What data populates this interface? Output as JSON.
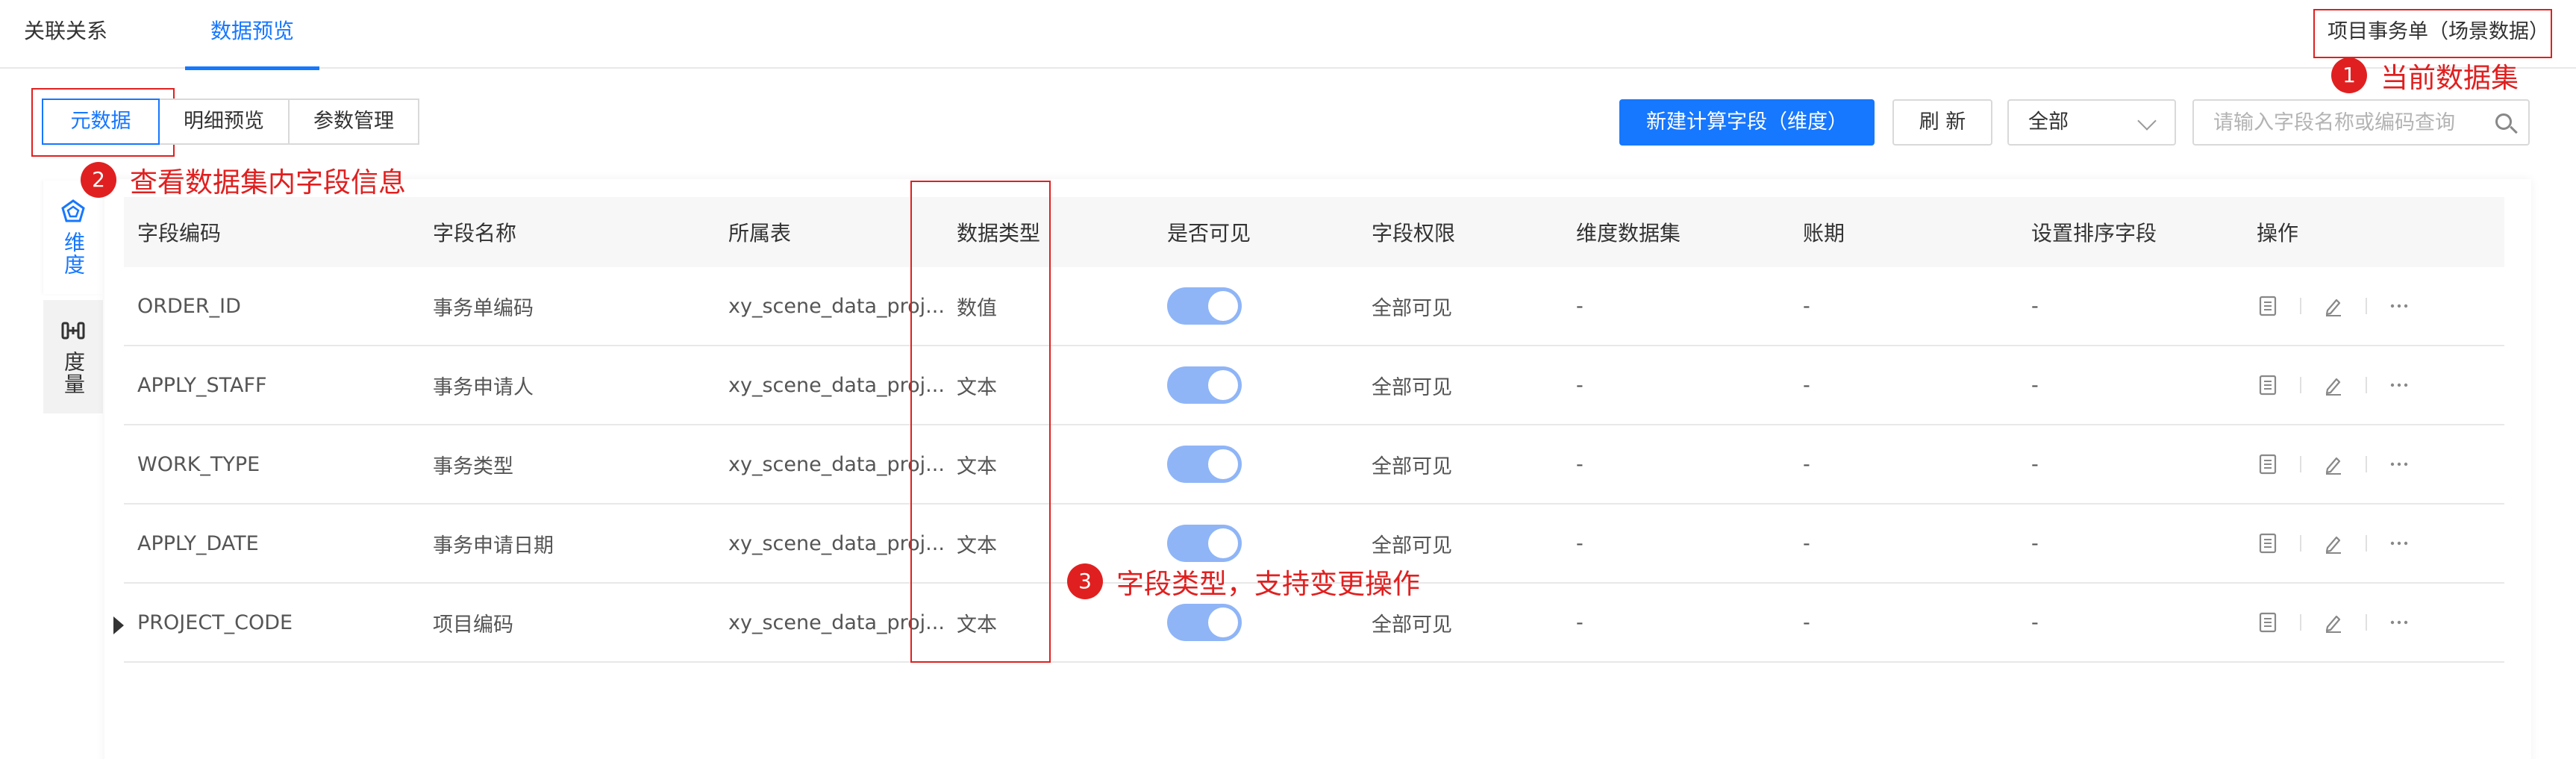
{
  "top_tabs": [
    "关联关系",
    "数据预览"
  ],
  "dataset_name": "项目事务单（场景数据）",
  "annotations": [
    {
      "num": "1",
      "text": "当前数据集"
    },
    {
      "num": "2",
      "text": "查看数据集内字段信息"
    },
    {
      "num": "3",
      "text": "字段类型，支持变更操作"
    }
  ],
  "view_tabs": [
    "元数据",
    "明细预览",
    "参数管理"
  ],
  "toolbar": {
    "new_field_label": "新建计算字段（维度）",
    "refresh_label": "刷 新",
    "filter_value": "全部",
    "search_placeholder": "请输入字段名称或编码查询"
  },
  "sidebar": {
    "dimension": "维度",
    "measure": "度量"
  },
  "table": {
    "columns": [
      "字段编码",
      "字段名称",
      "所属表",
      "数据类型",
      "是否可见",
      "字段权限",
      "维度数据集",
      "账期",
      "设置排序字段",
      "操作"
    ],
    "rows": [
      {
        "code": "ORDER_ID",
        "name": "事务单编码",
        "table": "xy_scene_data_proj...",
        "type": "数值",
        "visible": true,
        "permission": "全部可见",
        "dim_dataset": "-",
        "period": "-",
        "sort_field": "-"
      },
      {
        "code": "APPLY_STAFF",
        "name": "事务申请人",
        "table": "xy_scene_data_proj...",
        "type": "文本",
        "visible": true,
        "permission": "全部可见",
        "dim_dataset": "-",
        "period": "-",
        "sort_field": "-"
      },
      {
        "code": "WORK_TYPE",
        "name": "事务类型",
        "table": "xy_scene_data_proj...",
        "type": "文本",
        "visible": true,
        "permission": "全部可见",
        "dim_dataset": "-",
        "period": "-",
        "sort_field": "-"
      },
      {
        "code": "APPLY_DATE",
        "name": "事务申请日期",
        "table": "xy_scene_data_proj...",
        "type": "文本",
        "visible": true,
        "permission": "全部可见",
        "dim_dataset": "-",
        "period": "-",
        "sort_field": "-"
      },
      {
        "code": "PROJECT_CODE",
        "name": "项目编码",
        "table": "xy_scene_data_proj...",
        "type": "文本",
        "visible": true,
        "permission": "全部可见",
        "dim_dataset": "-",
        "period": "-",
        "sort_field": "-"
      }
    ]
  },
  "colors": {
    "accent": "#1677ff",
    "annotation": "#e02020",
    "toggle_on": "#8fb5f7"
  }
}
